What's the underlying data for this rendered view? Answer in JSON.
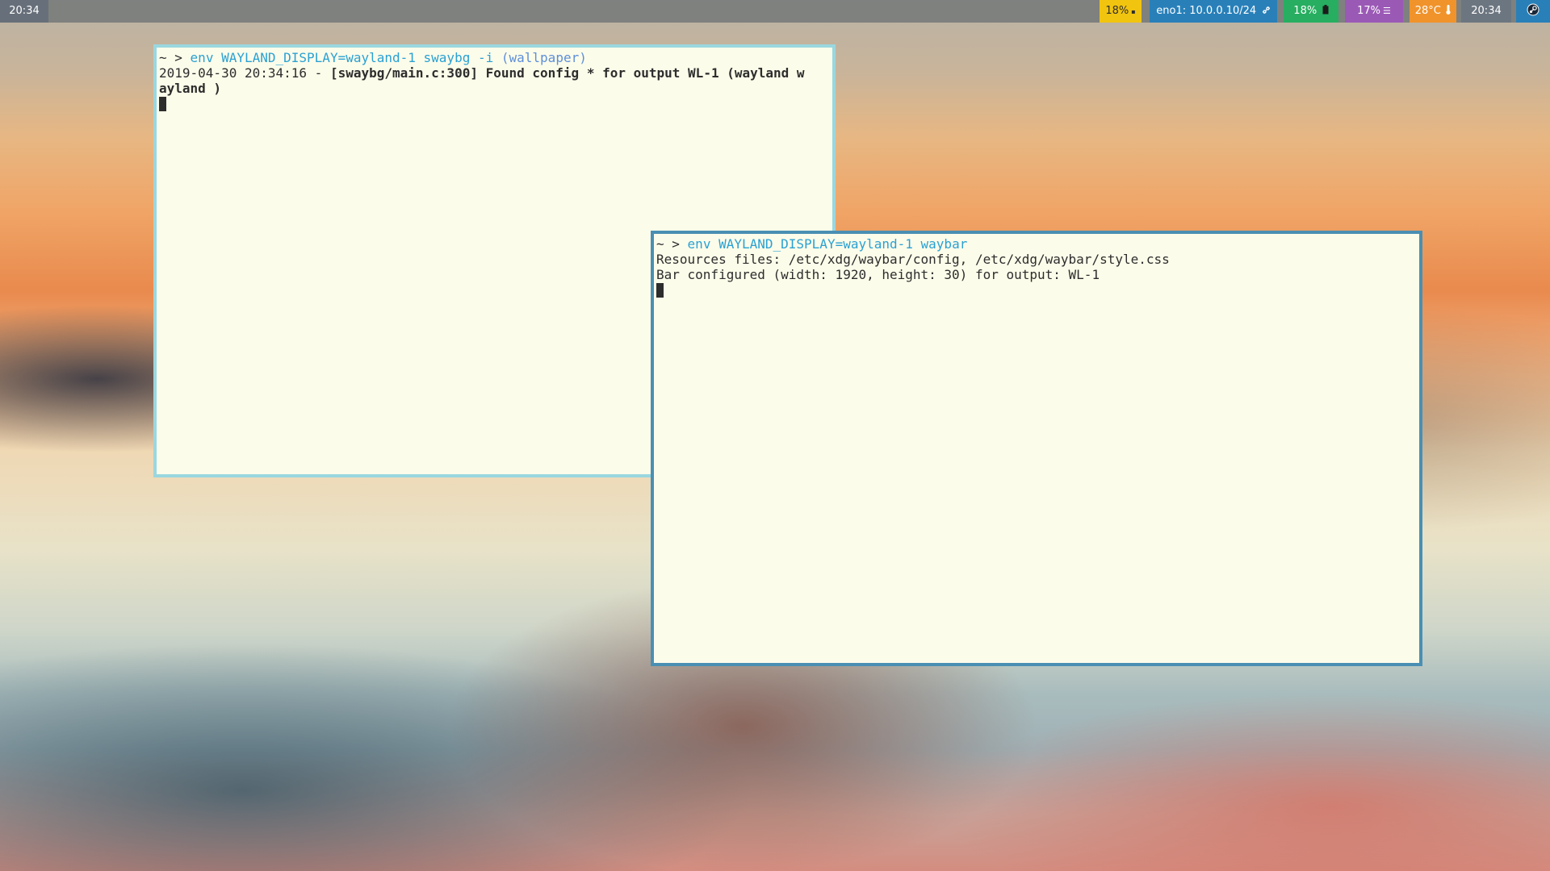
{
  "topbar": {
    "workspace_label": "20:34",
    "cpu": "18%",
    "network": "eno1: 10.0.0.10/24",
    "battery": "18%",
    "memory": "17%",
    "temperature": "28°C",
    "clock": "20:34"
  },
  "terminal1": {
    "prompt": "~ >",
    "command": "env WAYLAND_DISPLAY=wayland-1 swaybg -i",
    "paren_open": "(",
    "argument": "wallpaper",
    "paren_close": ")",
    "line2_timestamp": "2019-04-30 20:34:16 -",
    "line2_message": "[swaybg/main.c:300] Found config * for output WL-1 (wayland w",
    "line3_message": "ayland )"
  },
  "terminal2": {
    "prompt": "~ >",
    "command": "env WAYLAND_DISPLAY=wayland-1 waybar",
    "line2": "Resources files: /etc/xdg/waybar/config, /etc/xdg/waybar/style.css",
    "line3": "Bar configured (width: 1920, height: 30) for output: WL-1"
  },
  "icons": {
    "cpu": "cpu-icon",
    "network": "link-icon",
    "battery": "battery-icon",
    "memory": "memory-icon",
    "temperature": "thermometer-icon",
    "tray": "steam-icon"
  },
  "colors": {
    "cpu": "#f1c40f",
    "network": "#2980b9",
    "battery": "#27ae60",
    "memory": "#9b59b6",
    "temperature": "#f0932b",
    "command": "#2aa1d3"
  }
}
